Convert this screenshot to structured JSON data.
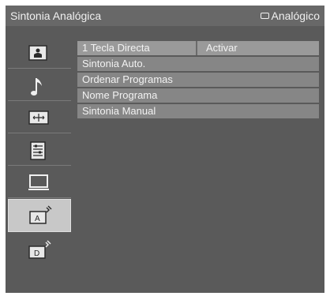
{
  "header": {
    "title": "Sintonia Analógica",
    "mode_icon": "rectangle-outline-icon",
    "mode_label": "Analógico"
  },
  "sidebar": {
    "items": [
      {
        "icon": "picture-icon",
        "selected": false
      },
      {
        "icon": "music-note-icon",
        "selected": false
      },
      {
        "icon": "screen-resize-icon",
        "selected": false
      },
      {
        "icon": "settings-list-icon",
        "selected": false
      },
      {
        "icon": "monitor-icon",
        "selected": false
      },
      {
        "icon": "analog-tuning-icon",
        "selected": true,
        "glyph": "A"
      },
      {
        "icon": "digital-tuning-icon",
        "selected": false,
        "glyph": "D"
      }
    ]
  },
  "menu": {
    "items": [
      {
        "label": "1 Tecla Directa",
        "value": "Activar"
      },
      {
        "label": "Sintonia Auto.",
        "value": ""
      },
      {
        "label": "Ordenar Programas",
        "value": ""
      },
      {
        "label": "Nome Programa",
        "value": ""
      },
      {
        "label": "Sintonia Manual",
        "value": ""
      }
    ]
  },
  "colors": {
    "background": "#5a5a5a",
    "title_bar": "#686868",
    "row": "#868686",
    "row_active": "#9a9a9a",
    "selected_sidebar": "#c8c8c8",
    "text": "#f2f2f2"
  }
}
